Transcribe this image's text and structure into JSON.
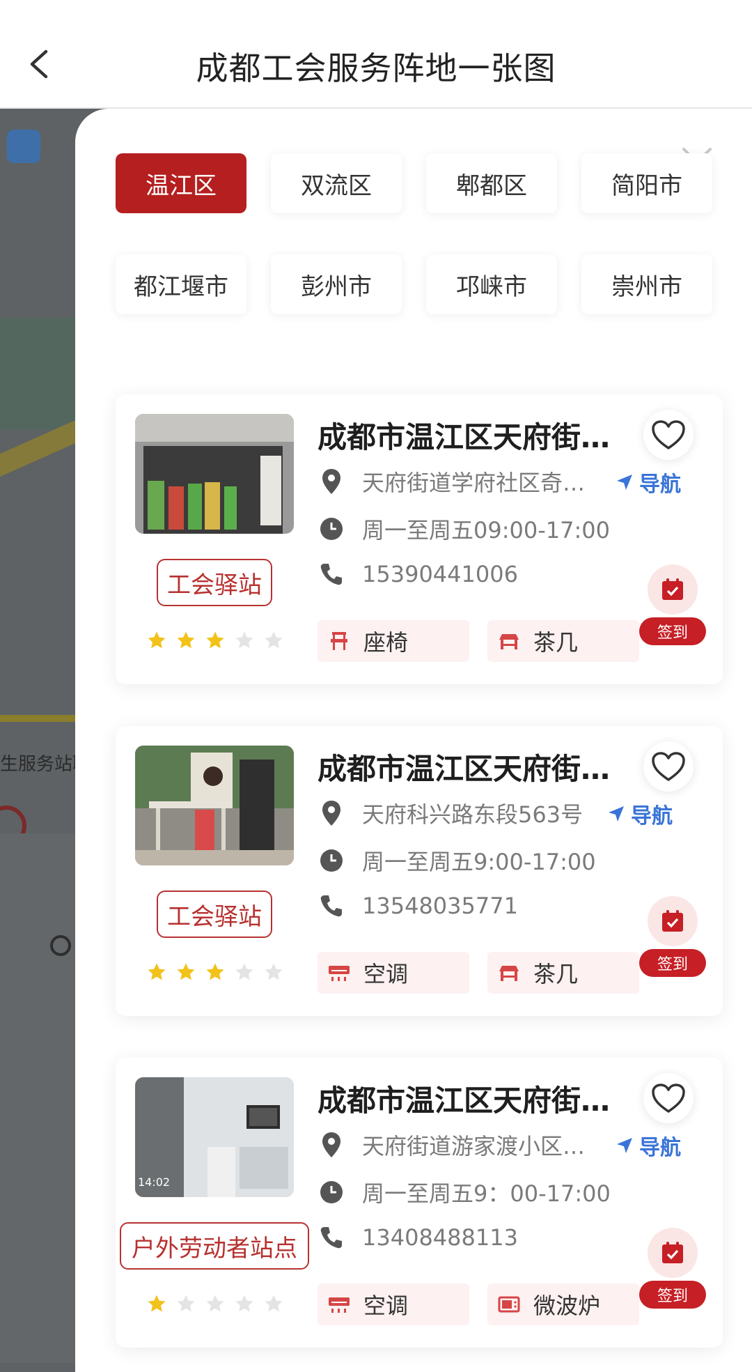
{
  "header": {
    "title": "成都工会服务阵地一张图"
  },
  "background": {
    "snippet": "生服务站职"
  },
  "districts": [
    "温江区",
    "双流区",
    "郫都区",
    "简阳市",
    "都江堰市",
    "彭州市",
    "邛崃市",
    "崇州市"
  ],
  "active_district": "温江区",
  "nav_label": "导航",
  "checkin_label": "签到",
  "stations": [
    {
      "name": "成都市温江区天府街…",
      "address": "天府街道学府社区奇…",
      "hours": "周一至周五09:00-17:00",
      "phone": "15390441006",
      "tag": "工会驿站",
      "rating": 3,
      "facilities": [
        {
          "label": "座椅",
          "icon": "chair-icon"
        },
        {
          "label": "茶几",
          "icon": "tea-table-icon"
        }
      ]
    },
    {
      "name": "成都市温江区天府街…",
      "address": "天府科兴路东段563号",
      "hours": "周一至周五9:00-17:00",
      "phone": "13548035771",
      "tag": "工会驿站",
      "rating": 3,
      "facilities": [
        {
          "label": "空调",
          "icon": "air-conditioner-icon"
        },
        {
          "label": "茶几",
          "icon": "tea-table-icon"
        }
      ]
    },
    {
      "name": "成都市温江区天府街…",
      "address": "天府街道游家渡小区…",
      "hours": "周一至周五9：00-17:00",
      "phone": "13408488113",
      "tag": "户外劳动者站点",
      "rating": 1,
      "facilities": [
        {
          "label": "空调",
          "icon": "air-conditioner-icon"
        },
        {
          "label": "微波炉",
          "icon": "microwave-icon"
        }
      ],
      "photo_overlay": "14:02"
    }
  ],
  "colors": {
    "primary": "#b51f1f",
    "nav_blue": "#3a74d8",
    "star_on": "#f2c21b",
    "star_off": "#e4e4e4"
  }
}
